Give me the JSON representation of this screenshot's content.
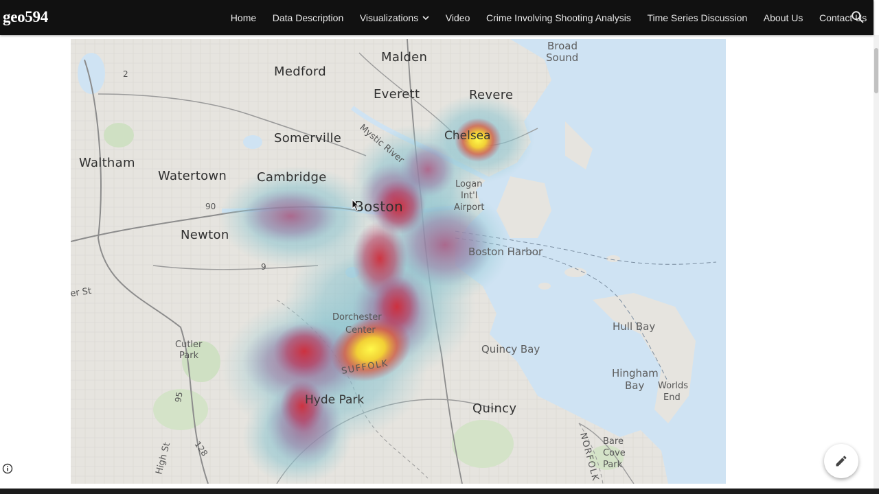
{
  "site": {
    "brand": "geo594"
  },
  "nav": {
    "items": [
      {
        "label": "Home"
      },
      {
        "label": "Data Description"
      },
      {
        "label": "Visualizations",
        "has_dropdown": true
      },
      {
        "label": "Video"
      },
      {
        "label": "Crime Involving Shooting Analysis"
      },
      {
        "label": "Time Series Discussion"
      },
      {
        "label": "About Us"
      },
      {
        "label": "Contact Us"
      }
    ],
    "search_icon": "search-icon"
  },
  "map": {
    "labels": {
      "malden": "Malden",
      "medford": "Medford",
      "everett": "Everett",
      "revere": "Revere",
      "broad_sound_1": "Broad",
      "broad_sound_2": "Sound",
      "chelsea": "Chelsea",
      "somerville": "Somerville",
      "waltham": "Waltham",
      "watertown": "Watertown",
      "cambridge": "Cambridge",
      "mystic_river": "Mystic River",
      "boston": "Boston",
      "logan_1": "Logan",
      "logan_2": "Int'l",
      "logan_3": "Airport",
      "newton": "Newton",
      "boston_harbor": "Boston Harbor",
      "dorchester_1": "Dorchester",
      "dorchester_2": "Center",
      "suffolk": "SUFFOLK",
      "cutler_1": "Cutler",
      "cutler_2": "Park",
      "quincy_bay": "Quincy Bay",
      "hull_bay": "Hull Bay",
      "hingham_1": "Hingham",
      "hingham_2": "Bay",
      "worlds_end_1": "Worlds",
      "worlds_end_2": "End",
      "hyde_park": "Hyde Park",
      "quincy": "Quincy",
      "norfolk": "NORFOLK",
      "bare_cove_1": "Bare",
      "bare_cove_2": "Cove",
      "bare_cove_3": "Park",
      "high_st": "High St",
      "main_st": "er St",
      "route_2": "2",
      "route_90": "90",
      "route_9": "9",
      "route_95": "95",
      "route_128": "128"
    },
    "colors": {
      "land": "#e6e4df",
      "water": "#cfe3f3",
      "heat_low": "#8fc3cc",
      "heat_mid": "#b7374f",
      "heat_high": "#fbf23a"
    }
  },
  "floating": {
    "info_icon": "info-icon",
    "edit_icon": "pencil-icon"
  }
}
